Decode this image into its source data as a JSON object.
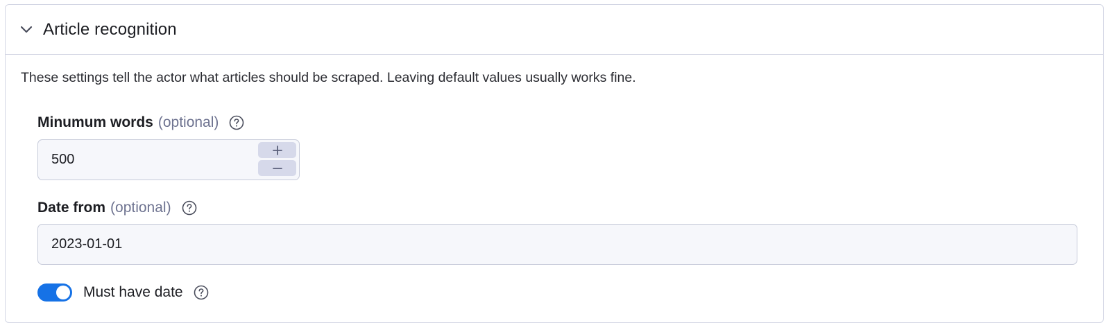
{
  "section": {
    "title": "Article recognition",
    "chevron_icon": "chevron-down-icon",
    "description": "These settings tell the actor what articles should be scraped. Leaving default values usually works fine."
  },
  "fields": {
    "min_words": {
      "label": "Minumum words",
      "optional": "(optional)",
      "value": "500",
      "help_icon": "question-circle-icon",
      "increment_icon": "plus-icon",
      "decrement_icon": "minus-icon"
    },
    "date_from": {
      "label": "Date from",
      "optional": "(optional)",
      "value": "2023-01-01",
      "help_icon": "question-circle-icon"
    },
    "must_have_date": {
      "label": "Must have date",
      "checked": true,
      "help_icon": "question-circle-icon"
    }
  },
  "colors": {
    "accent": "#1672e6",
    "border": "#d3d6e4",
    "input_bg": "#f6f7fb",
    "optional_text": "#6e7390",
    "stepper_bg": "#d6d9ea"
  }
}
